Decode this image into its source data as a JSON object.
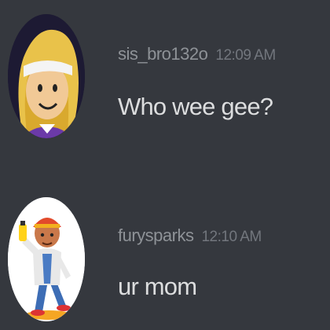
{
  "chat": {
    "messages": [
      {
        "username": "sis_bro132o",
        "timestamp": "12:09 AM",
        "content": "Who wee gee?",
        "avatar_icon": "roblox-blonde-girl-avatar-icon"
      },
      {
        "username": "furysparks",
        "timestamp": "12:10 AM",
        "content": "ur mom",
        "avatar_icon": "subway-surfers-jake-avatar-icon"
      }
    ]
  },
  "colors": {
    "background": "#36393f",
    "username": "#8e9297",
    "timestamp": "#72767d",
    "message_text": "#dcddde"
  }
}
